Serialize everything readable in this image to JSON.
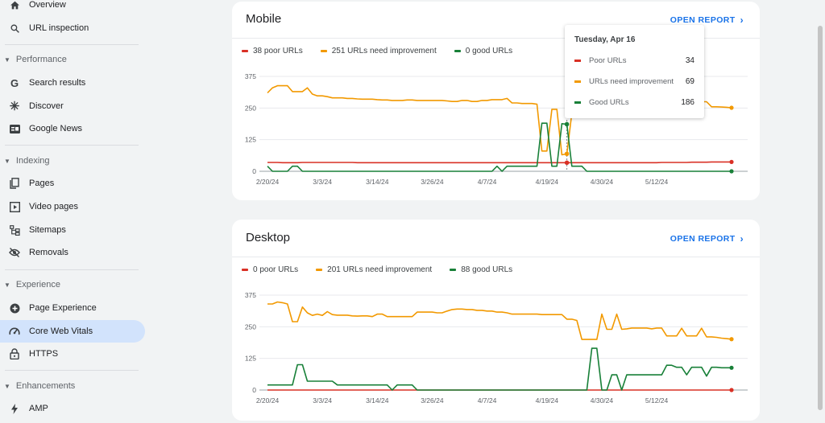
{
  "sidebar": {
    "top_items": [
      {
        "label": "Overview",
        "icon": "home-icon"
      },
      {
        "label": "URL inspection",
        "icon": "search-icon"
      }
    ],
    "sections": [
      {
        "label": "Performance",
        "items": [
          {
            "label": "Search results",
            "icon": "google-g-icon"
          },
          {
            "label": "Discover",
            "icon": "asterisk-icon"
          },
          {
            "label": "Google News",
            "icon": "news-icon"
          }
        ]
      },
      {
        "label": "Indexing",
        "items": [
          {
            "label": "Pages",
            "icon": "pages-icon"
          },
          {
            "label": "Video pages",
            "icon": "video-icon"
          },
          {
            "label": "Sitemaps",
            "icon": "sitemap-icon"
          },
          {
            "label": "Removals",
            "icon": "eye-off-icon"
          }
        ]
      },
      {
        "label": "Experience",
        "items": [
          {
            "label": "Page Experience",
            "icon": "plus-circle-icon"
          },
          {
            "label": "Core Web Vitals",
            "icon": "gauge-icon",
            "active": true
          },
          {
            "label": "HTTPS",
            "icon": "lock-icon"
          }
        ]
      },
      {
        "label": "Enhancements",
        "items": [
          {
            "label": "AMP",
            "icon": "bolt-icon"
          }
        ]
      }
    ]
  },
  "open_report_label": "OPEN REPORT",
  "colors": {
    "poor": "#d93025",
    "needs": "#f29900",
    "good": "#188038",
    "accent": "#1a73e8"
  },
  "mobile": {
    "title": "Mobile",
    "legend": {
      "poor": "38 poor URLs",
      "needs": "251 URLs need improvement",
      "good": "0 good URLs"
    },
    "tooltip": {
      "date": "Tuesday, Apr 16",
      "rows": [
        {
          "label": "Poor URLs",
          "value": "34",
          "color": "#d93025"
        },
        {
          "label": "URLs need improvement",
          "value": "69",
          "color": "#f29900"
        },
        {
          "label": "Good URLs",
          "value": "186",
          "color": "#188038"
        }
      ]
    }
  },
  "desktop": {
    "title": "Desktop",
    "legend": {
      "poor": "0 poor URLs",
      "needs": "201 URLs need improvement",
      "good": "88 good URLs"
    }
  },
  "chart_data": [
    {
      "type": "line",
      "title": "Mobile",
      "x_tick_labels": [
        "2/20/24",
        "3/3/24",
        "3/14/24",
        "3/26/24",
        "4/7/24",
        "4/19/24",
        "4/30/24",
        "5/12/24"
      ],
      "y_ticks": [
        0,
        125,
        250,
        375
      ],
      "ylim": [
        0,
        375
      ],
      "x_start": "2024-02-20",
      "hover_x": "2024-04-16",
      "series": [
        {
          "name": "poor URLs",
          "color": "#d93025",
          "values": [
            35,
            35,
            35,
            34,
            34,
            34,
            34,
            35,
            35,
            35,
            35,
            35,
            35,
            35,
            35,
            35,
            35,
            35,
            34,
            34,
            34,
            34,
            34,
            34,
            34,
            34,
            34,
            34,
            34,
            34,
            34,
            34,
            34,
            34,
            34,
            34,
            34,
            34,
            34,
            34,
            34,
            34,
            34,
            34,
            34,
            34,
            34,
            34,
            34,
            34,
            34,
            34,
            34,
            34,
            34,
            34,
            34,
            34,
            34,
            34,
            34,
            34,
            34,
            34,
            34,
            34,
            34,
            34,
            34,
            34,
            34,
            34,
            34,
            34,
            34,
            34,
            34,
            34,
            34,
            35,
            35,
            35,
            35,
            35,
            35,
            36,
            36,
            36,
            36,
            37,
            37,
            37,
            37,
            37
          ]
        },
        {
          "name": "URLs need improvement",
          "color": "#f29900",
          "values": [
            310,
            330,
            338,
            338,
            338,
            315,
            315,
            315,
            330,
            305,
            298,
            298,
            295,
            290,
            290,
            290,
            288,
            288,
            286,
            285,
            285,
            285,
            283,
            282,
            282,
            280,
            280,
            280,
            282,
            282,
            280,
            280,
            280,
            280,
            280,
            280,
            278,
            276,
            276,
            280,
            280,
            276,
            276,
            280,
            280,
            283,
            283,
            283,
            288,
            270,
            270,
            268,
            268,
            268,
            265,
            80,
            80,
            245,
            245,
            65,
            69,
            230,
            285,
            285,
            285,
            285,
            285,
            285,
            283,
            283,
            283,
            280,
            280,
            280,
            280,
            280,
            280,
            279,
            279,
            279,
            278,
            278,
            277,
            277,
            276,
            276,
            275,
            275,
            275,
            255,
            255,
            254,
            253,
            251
          ]
        },
        {
          "name": "good URLs",
          "color": "#188038",
          "values": [
            20,
            0,
            0,
            0,
            0,
            20,
            20,
            0,
            0,
            0,
            0,
            0,
            0,
            0,
            0,
            0,
            0,
            0,
            0,
            0,
            0,
            0,
            0,
            0,
            0,
            0,
            0,
            0,
            0,
            0,
            0,
            0,
            0,
            0,
            0,
            0,
            0,
            0,
            0,
            0,
            0,
            0,
            0,
            0,
            0,
            0,
            20,
            0,
            20,
            20,
            20,
            20,
            20,
            20,
            20,
            190,
            190,
            20,
            20,
            188,
            186,
            20,
            20,
            20,
            0,
            0,
            0,
            0,
            0,
            0,
            0,
            0,
            0,
            0,
            0,
            0,
            0,
            0,
            0,
            0,
            0,
            0,
            0,
            0,
            0,
            0,
            0,
            0,
            0,
            0,
            0,
            0,
            0,
            0
          ]
        }
      ]
    },
    {
      "type": "line",
      "title": "Desktop",
      "x_tick_labels": [
        "2/20/24",
        "3/3/24",
        "3/14/24",
        "3/26/24",
        "4/7/24",
        "4/19/24",
        "4/30/24",
        "5/12/24"
      ],
      "y_ticks": [
        0,
        125,
        250,
        375
      ],
      "ylim": [
        0,
        375
      ],
      "x_start": "2024-02-20",
      "series": [
        {
          "name": "poor URLs",
          "color": "#d93025",
          "values": [
            0,
            0,
            0,
            0,
            0,
            0,
            0,
            0,
            0,
            0,
            0,
            0,
            0,
            0,
            0,
            0,
            0,
            0,
            0,
            0,
            0,
            0,
            0,
            0,
            0,
            0,
            0,
            0,
            0,
            0,
            0,
            0,
            0,
            0,
            0,
            0,
            0,
            0,
            0,
            0,
            0,
            0,
            0,
            0,
            0,
            0,
            0,
            0,
            0,
            0,
            0,
            0,
            0,
            0,
            0,
            0,
            0,
            0,
            0,
            0,
            0,
            0,
            0,
            0,
            0,
            0,
            0,
            0,
            0,
            0,
            0,
            0,
            0,
            0,
            0,
            0,
            0,
            0,
            0,
            0,
            0,
            0,
            0,
            0,
            0,
            0,
            0,
            0,
            0,
            0,
            0,
            0,
            0,
            0
          ]
        },
        {
          "name": "URLs need improvement",
          "color": "#f29900",
          "values": [
            340,
            340,
            348,
            345,
            340,
            270,
            270,
            328,
            305,
            295,
            300,
            295,
            310,
            298,
            296,
            296,
            296,
            293,
            292,
            293,
            293,
            290,
            300,
            300,
            290,
            290,
            290,
            290,
            290,
            290,
            308,
            308,
            308,
            308,
            305,
            305,
            312,
            318,
            320,
            320,
            318,
            318,
            315,
            315,
            312,
            312,
            308,
            308,
            305,
            300,
            300,
            300,
            300,
            300,
            300,
            298,
            298,
            298,
            298,
            298,
            280,
            280,
            275,
            200,
            200,
            200,
            200,
            300,
            240,
            240,
            300,
            240,
            242,
            245,
            245,
            245,
            245,
            242,
            245,
            245,
            214,
            214,
            214,
            244,
            214,
            214,
            214,
            244,
            210,
            210,
            208,
            205,
            203,
            201
          ]
        },
        {
          "name": "good URLs",
          "color": "#188038",
          "values": [
            20,
            20,
            20,
            20,
            20,
            20,
            100,
            100,
            35,
            35,
            35,
            35,
            35,
            35,
            20,
            20,
            20,
            20,
            20,
            20,
            20,
            20,
            20,
            20,
            20,
            0,
            20,
            20,
            20,
            20,
            0,
            0,
            0,
            0,
            0,
            0,
            0,
            0,
            0,
            0,
            0,
            0,
            0,
            0,
            0,
            0,
            0,
            0,
            0,
            0,
            0,
            0,
            0,
            0,
            0,
            0,
            0,
            0,
            0,
            0,
            0,
            0,
            0,
            0,
            0,
            165,
            165,
            0,
            0,
            60,
            60,
            0,
            60,
            60,
            60,
            60,
            60,
            60,
            60,
            60,
            98,
            98,
            90,
            90,
            60,
            90,
            90,
            90,
            55,
            90,
            90,
            88,
            88,
            88
          ]
        }
      ]
    }
  ]
}
